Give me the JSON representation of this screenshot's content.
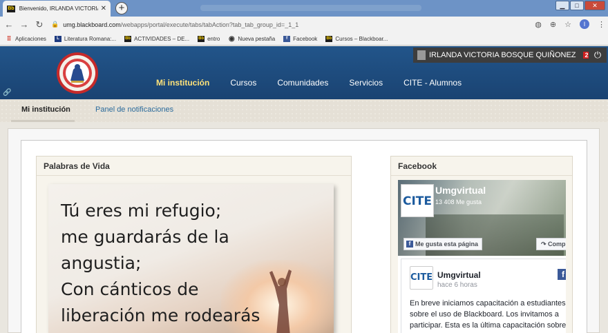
{
  "browser": {
    "tab_title": "Bienvenido, IRLANDA VICTORIA",
    "tab_favicon": "Bb",
    "url_host": "umg.blackboard.com",
    "url_path": "/webapps/portal/execute/tabs/tabAction?tab_tab_group_id=_1_1",
    "profile_initial": "I"
  },
  "bookmarks": [
    {
      "icon": "apps-icon",
      "label": "Aplicaciones"
    },
    {
      "icon": "L",
      "label": "Literatura Romana:..."
    },
    {
      "icon": "Bb",
      "label": "ACTIVIDADES – DE..."
    },
    {
      "icon": "Bb",
      "label": "entro"
    },
    {
      "icon": "globe-icon",
      "label": "Nueva pestaña"
    },
    {
      "icon": "f",
      "label": "Facebook"
    },
    {
      "icon": "Bb",
      "label": "Cursos – Blackboar..."
    }
  ],
  "user": {
    "name": "IRLANDA VICTORIA BOSQUE QUIÑONEZ",
    "notifications": "2"
  },
  "nav": [
    {
      "label": "Mi institución",
      "active": true
    },
    {
      "label": "Cursos"
    },
    {
      "label": "Comunidades"
    },
    {
      "label": "Servicios"
    },
    {
      "label": "CITE - Alumnos"
    }
  ],
  "subtabs": {
    "active": "Mi institución",
    "other": "Panel de notificaciones"
  },
  "modules": {
    "verse": {
      "title": "Palabras de Vida",
      "lines": [
        "Tú eres mi refugio;",
        "me guardarás de la",
        "angustia;",
        "Con cánticos de",
        "liberación me rodearás"
      ]
    },
    "facebook": {
      "title": "Facebook",
      "page_name": "Umgvirtual",
      "likes": "13 408 Me gusta",
      "like_button": "Me gusta esta página",
      "share_button": "Comp",
      "logo_text": "CITE",
      "post_author": "Umgvirtual",
      "post_time": "hace 6 horas",
      "post_text": "En breve iniciamos capacitación a estudiantes sobre el uso de Blackboard. Los invitamos a participar. Esta es la última capacitación sobre este será que harmas"
    }
  },
  "colors": {
    "header": "#1e4d7d",
    "nav_active": "#ffe27a",
    "link": "#2b6b9c",
    "badge": "#d21f1f"
  }
}
